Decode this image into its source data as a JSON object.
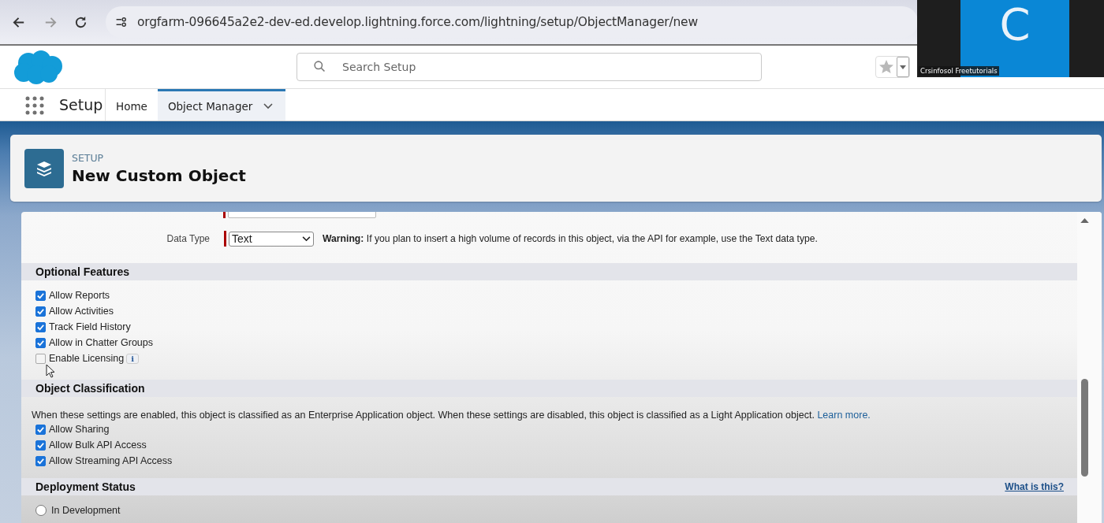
{
  "browser": {
    "url": "orgfarm-096645a2e2-dev-ed.develop.lightning.force.com/lightning/setup/ObjectManager/new"
  },
  "header": {
    "search": {
      "placeholder": "Search Setup"
    }
  },
  "nav": {
    "app_name": "Setup",
    "tabs": [
      {
        "label": "Home",
        "selected": false,
        "dropdown": false
      },
      {
        "label": "Object Manager",
        "selected": true,
        "dropdown": true
      }
    ]
  },
  "page_header": {
    "eyebrow": "SETUP",
    "title": "New Custom Object"
  },
  "data_type": {
    "label": "Data Type",
    "value": "Text",
    "required": true,
    "warning": "**Warning:** If you plan to insert a high volume of records in this object, via the API for example, use the Text data type."
  },
  "sections": [
    {
      "title": "Optional Features",
      "options": [
        {
          "label": "Allow Reports",
          "kind": "checkbox",
          "checked": true
        },
        {
          "label": "Allow Activities",
          "kind": "checkbox",
          "checked": true
        },
        {
          "label": "Track Field History",
          "kind": "checkbox",
          "checked": true
        },
        {
          "label": "Allow in Chatter Groups",
          "kind": "checkbox",
          "checked": true
        },
        {
          "label": "Enable Licensing",
          "kind": "checkbox",
          "checked": false,
          "info": "i"
        }
      ]
    },
    {
      "title": "Object Classification",
      "description": "When these settings are enabled, this object is classified as an Enterprise Application object. When these settings are disabled, this object is classified as a Light Application object.",
      "link": "Learn more.",
      "options": [
        {
          "label": "Allow Sharing",
          "kind": "checkbox",
          "checked": true
        },
        {
          "label": "Allow Bulk API Access",
          "kind": "checkbox",
          "checked": true
        },
        {
          "label": "Allow Streaming API Access",
          "kind": "checkbox",
          "checked": true
        }
      ]
    },
    {
      "title": "Deployment Status",
      "help_link": "What is this?",
      "options": [
        {
          "label": "In Development",
          "kind": "radio",
          "selected": false
        }
      ]
    }
  ],
  "video_tile": {
    "initial": "C",
    "caption": "Crsinfosol Freetutorials"
  }
}
